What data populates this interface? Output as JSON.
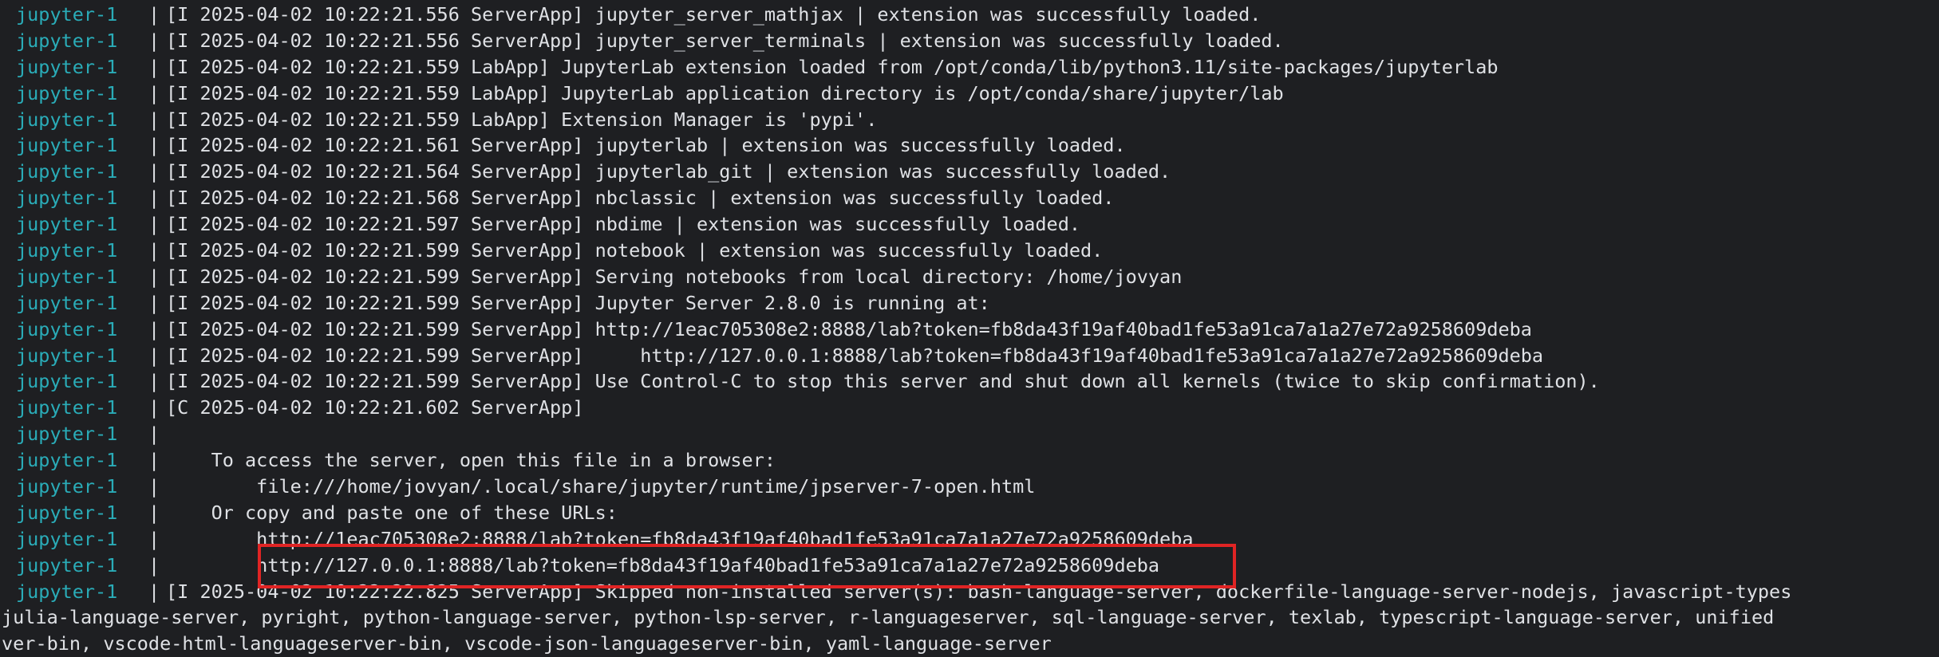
{
  "terminal": {
    "lines": [
      {
        "prefix": "jupyter-1",
        "sep": "|",
        "text": "[I 2025-04-02 10:22:21.556 ServerApp] jupyter_server_mathjax | extension was successfully loaded."
      },
      {
        "prefix": "jupyter-1",
        "sep": "|",
        "text": "[I 2025-04-02 10:22:21.556 ServerApp] jupyter_server_terminals | extension was successfully loaded."
      },
      {
        "prefix": "jupyter-1",
        "sep": "|",
        "text": "[I 2025-04-02 10:22:21.559 LabApp] JupyterLab extension loaded from /opt/conda/lib/python3.11/site-packages/jupyterlab"
      },
      {
        "prefix": "jupyter-1",
        "sep": "|",
        "text": "[I 2025-04-02 10:22:21.559 LabApp] JupyterLab application directory is /opt/conda/share/jupyter/lab"
      },
      {
        "prefix": "jupyter-1",
        "sep": "|",
        "text": "[I 2025-04-02 10:22:21.559 LabApp] Extension Manager is 'pypi'."
      },
      {
        "prefix": "jupyter-1",
        "sep": "|",
        "text": "[I 2025-04-02 10:22:21.561 ServerApp] jupyterlab | extension was successfully loaded."
      },
      {
        "prefix": "jupyter-1",
        "sep": "|",
        "text": "[I 2025-04-02 10:22:21.564 ServerApp] jupyterlab_git | extension was successfully loaded."
      },
      {
        "prefix": "jupyter-1",
        "sep": "|",
        "text": "[I 2025-04-02 10:22:21.568 ServerApp] nbclassic | extension was successfully loaded."
      },
      {
        "prefix": "jupyter-1",
        "sep": "|",
        "text": "[I 2025-04-02 10:22:21.597 ServerApp] nbdime | extension was successfully loaded."
      },
      {
        "prefix": "jupyter-1",
        "sep": "|",
        "text": "[I 2025-04-02 10:22:21.599 ServerApp] notebook | extension was successfully loaded."
      },
      {
        "prefix": "jupyter-1",
        "sep": "|",
        "text": "[I 2025-04-02 10:22:21.599 ServerApp] Serving notebooks from local directory: /home/jovyan"
      },
      {
        "prefix": "jupyter-1",
        "sep": "|",
        "text": "[I 2025-04-02 10:22:21.599 ServerApp] Jupyter Server 2.8.0 is running at:"
      },
      {
        "prefix": "jupyter-1",
        "sep": "|",
        "text": "[I 2025-04-02 10:22:21.599 ServerApp] http://1eac705308e2:8888/lab?token=fb8da43f19af40bad1fe53a91ca7a1a27e72a9258609deba"
      },
      {
        "prefix": "jupyter-1",
        "sep": "|",
        "text": "[I 2025-04-02 10:22:21.599 ServerApp]     http://127.0.0.1:8888/lab?token=fb8da43f19af40bad1fe53a91ca7a1a27e72a9258609deba"
      },
      {
        "prefix": "jupyter-1",
        "sep": "|",
        "text": "[I 2025-04-02 10:22:21.599 ServerApp] Use Control-C to stop this server and shut down all kernels (twice to skip confirmation)."
      },
      {
        "prefix": "jupyter-1",
        "sep": "|",
        "text": "[C 2025-04-02 10:22:21.602 ServerApp]"
      },
      {
        "prefix": "jupyter-1",
        "sep": "|",
        "text": ""
      },
      {
        "prefix": "jupyter-1",
        "sep": "|",
        "text": "    To access the server, open this file in a browser:"
      },
      {
        "prefix": "jupyter-1",
        "sep": "|",
        "text": "        file:///home/jovyan/.local/share/jupyter/runtime/jpserver-7-open.html"
      },
      {
        "prefix": "jupyter-1",
        "sep": "|",
        "text": "    Or copy and paste one of these URLs:"
      },
      {
        "prefix": "jupyter-1",
        "sep": "|",
        "text": "        http://1eac705308e2:8888/lab?token=fb8da43f19af40bad1fe53a91ca7a1a27e72a9258609deba"
      },
      {
        "prefix": "jupyter-1",
        "sep": "|",
        "text": "        http://127.0.0.1:8888/lab?token=fb8da43f19af40bad1fe53a91ca7a1a27e72a9258609deba"
      },
      {
        "prefix": "jupyter-1",
        "sep": "|",
        "text": "[I 2025-04-02 10:22:22.825 ServerApp] Skipped non-installed server(s): bash-language-server, dockerfile-language-server-nodejs, javascript-types"
      },
      {
        "prefix": "",
        "sep": "",
        "text": "julia-language-server, pyright, python-language-server, python-lsp-server, r-languageserver, sql-language-server, texlab, typescript-language-server, unified"
      },
      {
        "prefix": "",
        "sep": "",
        "text": "ver-bin, vscode-html-languageserver-bin, vscode-json-languageserver-bin, yaml-language-server"
      }
    ]
  },
  "colors": {
    "background": "#1e1f22",
    "prefix": "#2aacb8",
    "text": "#dfe1e5",
    "highlight_border": "#e02424"
  }
}
